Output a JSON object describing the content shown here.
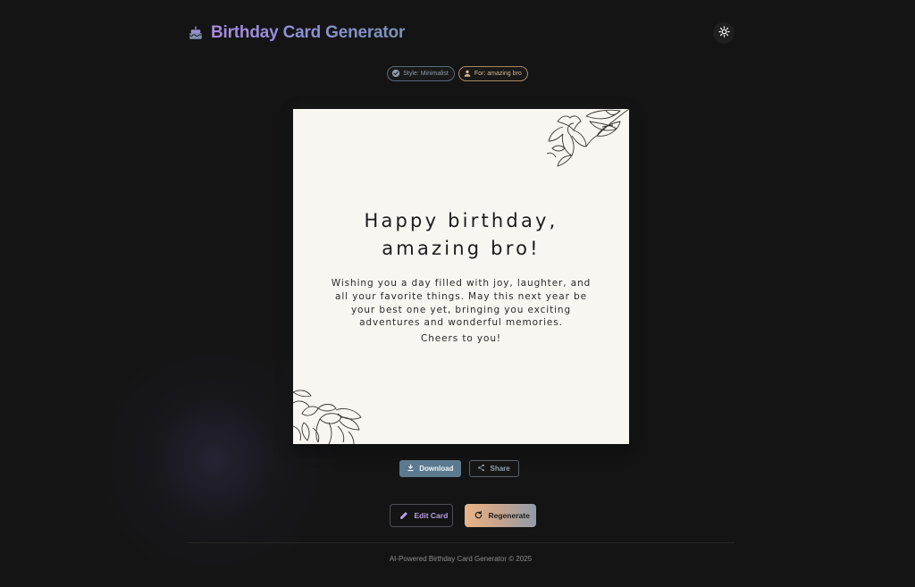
{
  "header": {
    "title_part1": "Birthday",
    "title_part2": "Card Generator",
    "icon": "cake-icon",
    "theme_toggle_icon": "sun-icon"
  },
  "tags": {
    "style": {
      "label": "Style: Minimalist",
      "icon": "check-circle-icon"
    },
    "recipient": {
      "label": "For: amazing bro",
      "icon": "person-icon"
    }
  },
  "card": {
    "heading_line1": "Happy birthday,",
    "heading_line2": "amazing bro!",
    "message": "Wishing you a day filled with joy, laughter, and all your favorite things. May this next year be your best one yet, bringing you exciting adventures and wonderful memories.",
    "signoff": "Cheers to you!",
    "decoration": "floral-line-art"
  },
  "actions": {
    "download_label": "Download",
    "download_icon": "download-icon",
    "share_label": "Share",
    "share_icon": "share-icon",
    "edit_label": "Edit Card",
    "edit_icon": "pencil-icon",
    "regenerate_label": "Regenerate",
    "regenerate_icon": "refresh-icon"
  },
  "footer": {
    "text": "AI-Powered Birthday Card Generator © 2025"
  },
  "colors": {
    "background": "#141414",
    "title_gradient_start": "#a88be0",
    "title_gradient_end": "#7a94b4",
    "card_background": "#f8f6f1",
    "download_button": "#5b7a8f",
    "regenerate_gradient_start": "#e9b488",
    "regenerate_gradient_end": "#8f9cab"
  }
}
